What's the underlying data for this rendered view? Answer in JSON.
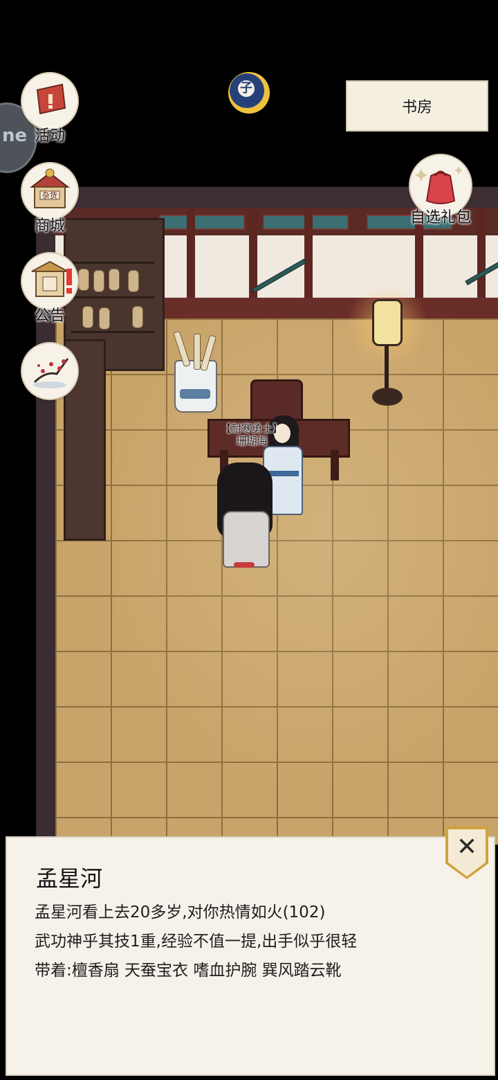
{
  "location": {
    "title": "书房"
  },
  "side_menu": [
    {
      "id": "activity",
      "label": "活动"
    },
    {
      "id": "shop",
      "label": "商城"
    },
    {
      "id": "notice",
      "label": "公告"
    },
    {
      "id": "scenery",
      "label": ""
    }
  ],
  "shop_sign": "杂货",
  "left_tab_text": "ne",
  "moon_glyph": "子",
  "gift_pack": {
    "label": "自选礼包"
  },
  "npc_tag": {
    "title": "【耐寒勇士】",
    "name": "珊瑚海"
  },
  "info_panel": {
    "name": "孟星河",
    "line1": "孟星河看上去20多岁,对你热情如火(102)",
    "line2": "武功神乎其技1重,经验不值一提,出手似乎很轻",
    "line3": "带着:檀香扇 天蚕宝衣 嗜血护腕 巽风踏云靴"
  },
  "colors": {
    "panel_bg": "#f6f2ea",
    "floor": "#c8a46a",
    "close_accent": "#d2a33c"
  }
}
